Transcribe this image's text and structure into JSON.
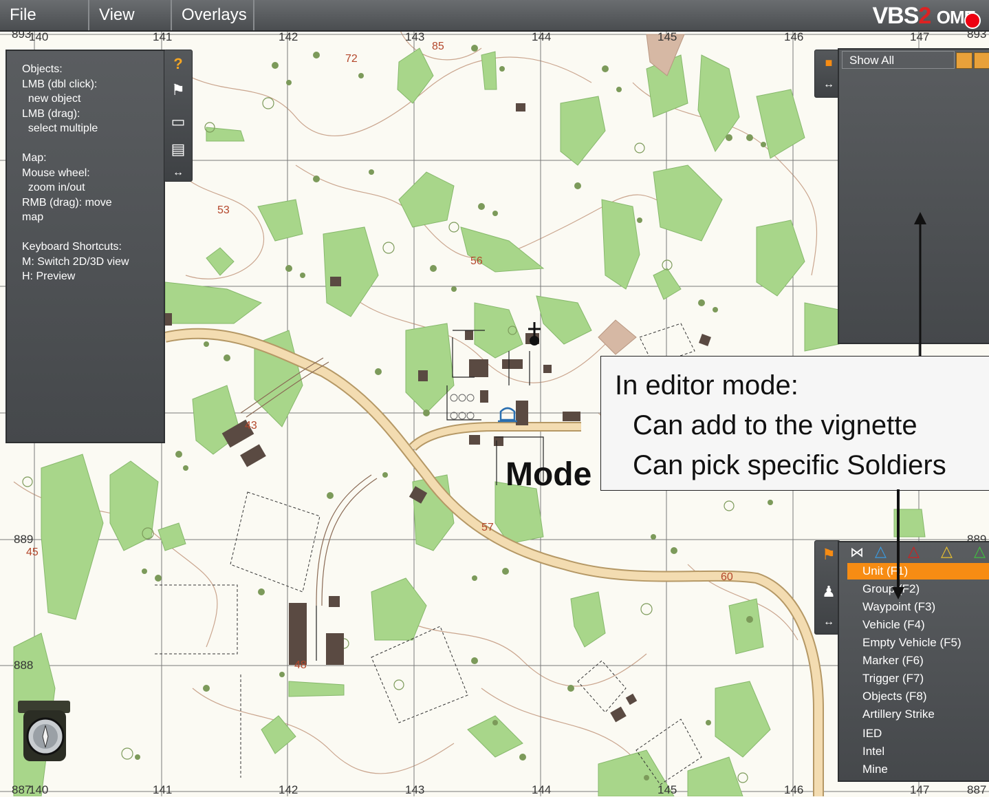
{
  "menu": {
    "file": "File",
    "view": "View",
    "overlays": "Overlays"
  },
  "brand": {
    "vbs": "VBS",
    "two": "2",
    "ome": "OME"
  },
  "help": {
    "text": "Objects:\nLMB (dbl click):\n  new object\nLMB (drag):\n  select multiple\n\nMap:\nMouse wheel:\n  zoom in/out\nRMB (drag): move\nmap\n\nKeyboard Shortcuts:\nM: Switch 2D/3D view\nH: Preview"
  },
  "filter": {
    "show_all": "Show All"
  },
  "unit_list": [
    "Unit (F1)",
    "Group (F2)",
    "Waypoint (F3)",
    "Vehicle (F4)",
    "Empty Vehicle (F5)",
    "Marker (F6)",
    "Trigger (F7)",
    "Objects (F8)",
    "Artillery Strike",
    "IED",
    "Intel",
    "Mine"
  ],
  "callout": {
    "line1": "In editor mode:",
    "line2": "Can add to the vignette",
    "line3": "Can pick specific Soldiers"
  },
  "mode_label": "Mode",
  "grid": {
    "top": [
      "893",
      "140",
      "141",
      "142",
      "143",
      "144",
      "145",
      "146",
      "147",
      "893"
    ],
    "bottom": [
      "887",
      "140",
      "141",
      "142",
      "143",
      "144",
      "145",
      "146",
      "147",
      "887"
    ],
    "left": [
      "889",
      "888"
    ],
    "right": [
      "889"
    ]
  },
  "elevations": [
    "85",
    "72",
    "53",
    "56",
    "57",
    "60",
    "45",
    "48",
    "43"
  ],
  "colors": {
    "vegetation": "#a8d68a",
    "road": "#f3dcb1",
    "contour": "#c9a58c",
    "grid": "#7a7a7a",
    "selection": "#f78c13",
    "panel": "#4e5154"
  }
}
